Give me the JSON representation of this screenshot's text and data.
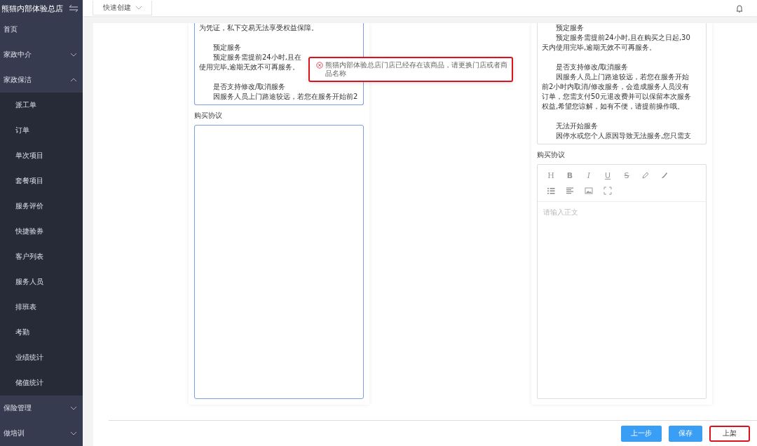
{
  "sidebar": {
    "title": "熊猫内部体验总店",
    "items": [
      {
        "label": "首页"
      },
      {
        "label": "家政中介",
        "expanded": false
      },
      {
        "label": "家政保洁",
        "expanded": true,
        "children": [
          {
            "label": "派工单"
          },
          {
            "label": "订单"
          },
          {
            "label": "单次项目"
          },
          {
            "label": "套餐项目"
          },
          {
            "label": "服务评价"
          },
          {
            "label": "快捷验券"
          },
          {
            "label": "客户列表"
          },
          {
            "label": "服务人员"
          },
          {
            "label": "排班表"
          },
          {
            "label": "考勤"
          },
          {
            "label": "业绩统计"
          },
          {
            "label": "储值统计"
          }
        ]
      },
      {
        "label": "保险管理",
        "expanded": false
      },
      {
        "label": "做培训",
        "expanded": false
      }
    ]
  },
  "header": {
    "quick_create": "快速创建"
  },
  "toast": {
    "kind": "error",
    "message": "熊猫内部体验总店门店已经存在该商品，请更换门店或者商品名称",
    "highlighted": true
  },
  "panels": [
    {
      "description": {
        "focused": true,
        "paragraphs": [
          {
            "lines": [
              {
                "text": "为凭证，私下交易无法享受权益保障。",
                "indent": false
              }
            ]
          },
          {
            "lines": [
              {
                "text": "预定服务",
                "indent": true
              },
              {
                "text": "预定服务需提前24小时,且在",
                "indent": true
              },
              {
                "text": "使用完毕,逾期无效不可再服务。",
                "indent": false
              }
            ]
          },
          {
            "lines": [
              {
                "text": "是否支持修改/取消服务",
                "indent": true
              },
              {
                "text": "因服务人员上门路途较远，若您在服务开始前2",
                "indent": true
              }
            ]
          }
        ]
      },
      "agreement_label": "购买协议",
      "agreement": {
        "kind": "textarea",
        "focused": true
      }
    },
    {
      "description": {
        "focused": false,
        "paragraphs": [
          {
            "lines": [
              {
                "text": "预定服务",
                "indent": true
              },
              {
                "text": "预定服务需提前24小时,且在购买之日起,30",
                "indent": true
              },
              {
                "text": "天内使用完毕,逾期无效不可再服务。",
                "indent": false
              }
            ]
          },
          {
            "lines": [
              {
                "text": "是否支持修改/取消服务",
                "indent": true
              },
              {
                "text": "因服务人员上门路途较远，若您在服务开始",
                "indent": true
              },
              {
                "text": "前2小时内取消/修改服务，会造成服务人员没有",
                "indent": false
              },
              {
                "text": "订单，您需支付50元退改费并可以保留本次服务",
                "indent": false
              },
              {
                "text": "权益,希望您谅解，如有不便，请提前操作哦。",
                "indent": false
              }
            ]
          },
          {
            "lines": [
              {
                "text": "无法开始服务",
                "indent": true
              },
              {
                "text": "因停水或您个人原因导致无法服务,您只需支",
                "indent": true
              }
            ]
          }
        ]
      },
      "agreement_label": "购买协议",
      "agreement": {
        "kind": "rich_editor",
        "placeholder": "请输入正文",
        "toolbar": [
          {
            "kind": "heading",
            "text": "H"
          },
          {
            "kind": "bold",
            "text": "B"
          },
          {
            "kind": "italic",
            "text": "I"
          },
          {
            "kind": "underline",
            "text": "U"
          },
          {
            "kind": "strike",
            "text": "S"
          },
          {
            "kind": "pen"
          },
          {
            "kind": "brush"
          },
          {
            "kind": "break"
          },
          {
            "kind": "list"
          },
          {
            "kind": "align"
          },
          {
            "kind": "image"
          },
          {
            "kind": "fullscreen"
          }
        ]
      }
    }
  ],
  "footer": {
    "buttons": [
      {
        "label": "上一步",
        "kind": "primary",
        "highlighted": false
      },
      {
        "label": "保存",
        "kind": "primary",
        "highlighted": false
      },
      {
        "label": "上架",
        "kind": "default",
        "highlighted": true
      }
    ]
  }
}
